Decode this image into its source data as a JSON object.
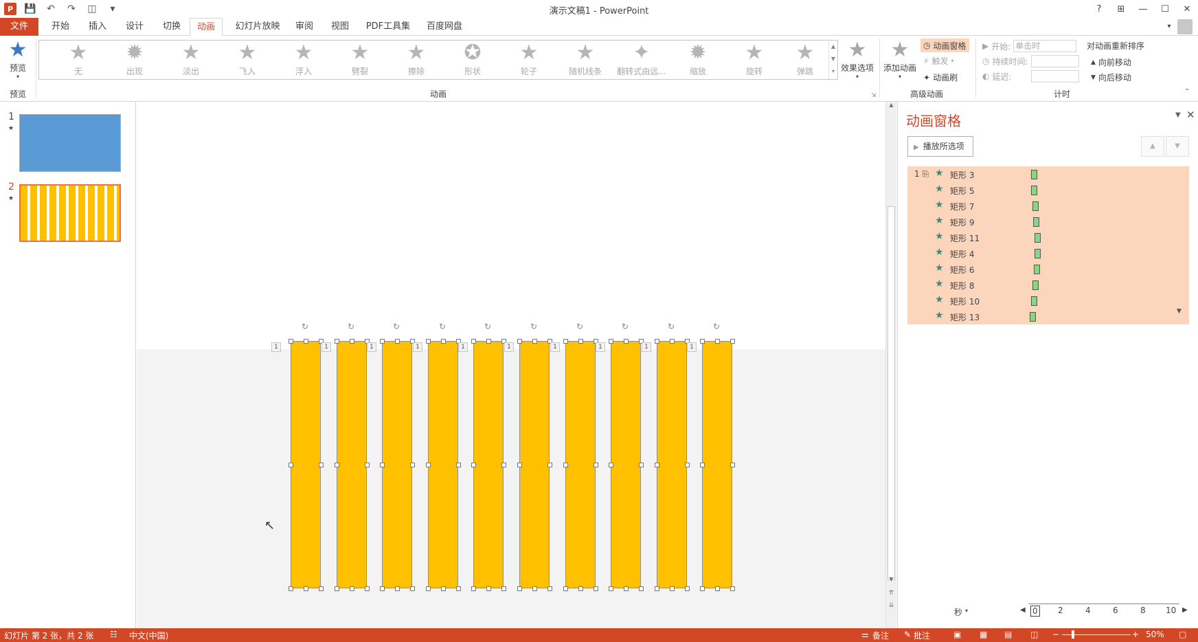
{
  "window": {
    "title": "演示文稿1 - PowerPoint",
    "help": "?",
    "minimize": "—",
    "maximize": "☐",
    "close": "✕"
  },
  "tabs": [
    {
      "label": "文件"
    },
    {
      "label": "开始"
    },
    {
      "label": "插入"
    },
    {
      "label": "设计"
    },
    {
      "label": "切换"
    },
    {
      "label": "动画"
    },
    {
      "label": "幻灯片放映"
    },
    {
      "label": "审阅"
    },
    {
      "label": "视图"
    },
    {
      "label": "PDF工具集"
    },
    {
      "label": "百度网盘"
    }
  ],
  "ribbon": {
    "preview": {
      "button": "预览",
      "group": "预览"
    },
    "animations": {
      "group": "动画",
      "items": [
        "无",
        "出现",
        "淡出",
        "飞入",
        "浮入",
        "劈裂",
        "擦除",
        "形状",
        "轮子",
        "随机线条",
        "翻转式由远...",
        "缩放",
        "旋转",
        "弹跳"
      ],
      "effect_options": "效果选项"
    },
    "advanced": {
      "group": "高级动画",
      "add_animation": "添加动画",
      "animation_pane": "动画窗格",
      "trigger": "触发",
      "painter": "动画刷"
    },
    "timing": {
      "group": "计时",
      "start_label": "开始:",
      "start_value": "单击时",
      "duration_label": "持续时间:",
      "delay_label": "延迟:",
      "reorder": "对动画重新排序",
      "move_earlier": "向前移动",
      "move_later": "向后移动"
    }
  },
  "slides": [
    {
      "number": "1",
      "color": "#5b9bd5"
    },
    {
      "number": "2",
      "color": "#ffc000"
    }
  ],
  "slide_canvas": {
    "shape_color": "#ffc000",
    "shape_count": 10,
    "sequence_tag": "1"
  },
  "animation_pane": {
    "title": "动画窗格",
    "play_button": "播放所选项",
    "first_sequence": "1",
    "items": [
      "矩形 3",
      "矩形 5",
      "矩形 7",
      "矩形 9",
      "矩形 11",
      "矩形 4",
      "矩形 6",
      "矩形 8",
      "矩形 10",
      "矩形 13"
    ],
    "timeline_unit": "秒",
    "ticks": [
      "0",
      "2",
      "4",
      "6",
      "8",
      "10"
    ]
  },
  "statusbar": {
    "slide_info": "幻灯片 第 2 张，共 2 张",
    "language": "中文(中国)",
    "notes": "备注",
    "comments": "批注",
    "zoom": "50%"
  }
}
